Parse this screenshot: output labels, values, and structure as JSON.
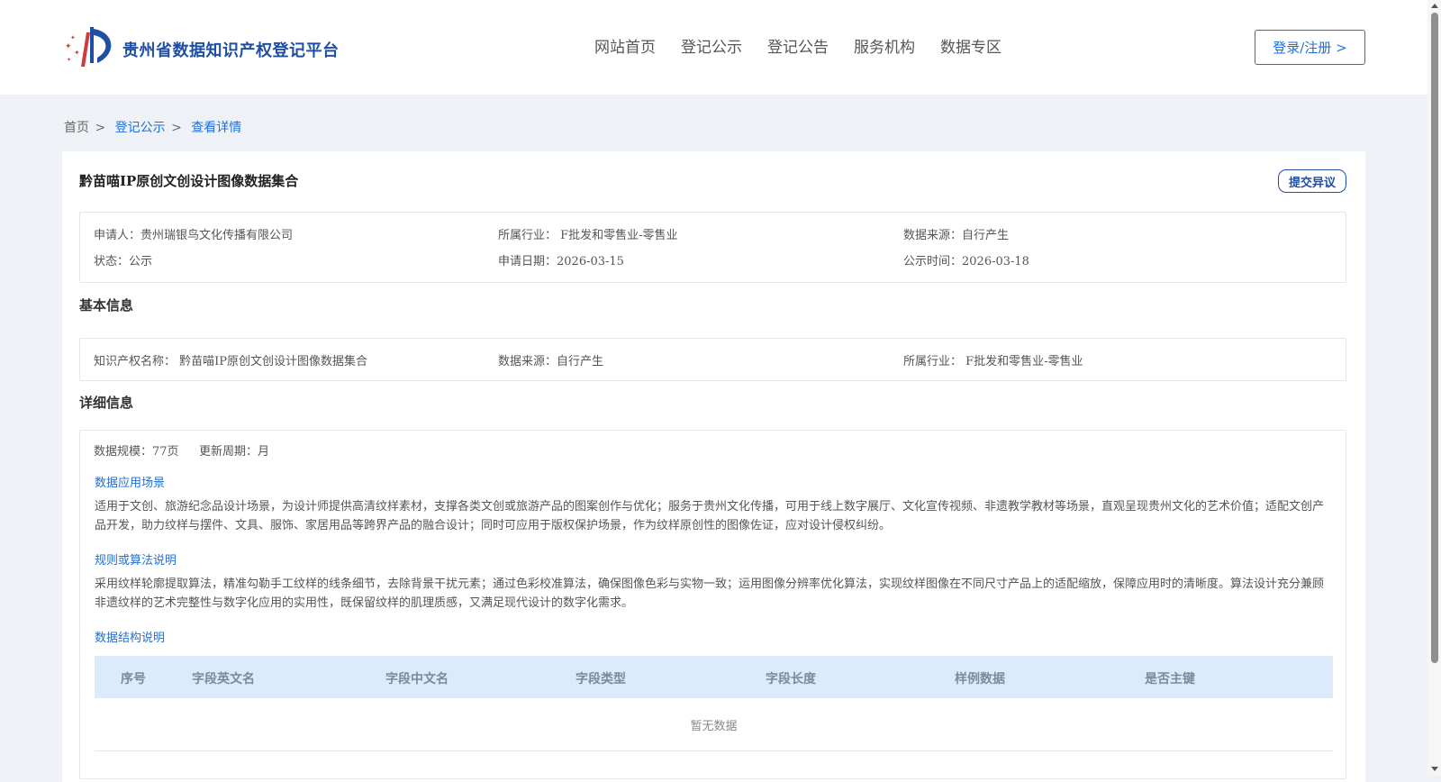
{
  "header": {
    "brand": "贵州省数据知识产权登记平台",
    "nav": [
      "网站首页",
      "登记公示",
      "登记公告",
      "服务机构",
      "数据专区"
    ],
    "login_label": "登录/注册 >"
  },
  "breadcrumb": {
    "home": "首页",
    "sep": ">",
    "list": "登记公示",
    "detail": "查看详情"
  },
  "record": {
    "title": "黔苗喵IP原创文创设计图像数据集合",
    "objection_label": "提交异议",
    "summary": {
      "applicant": "申请人：贵州瑞银鸟文化传播有限公司",
      "industry": "所属行业： F批发和零售业-零售业",
      "source": "数据来源：自行产生",
      "status": "状态：公示",
      "apply_date": "申请日期：2026-03-15",
      "publish_time": "公示时间：2026-03-18"
    }
  },
  "basic": {
    "title": "基本信息",
    "ip_name": "知识产权名称： 黔苗喵IP原创文创设计图像数据集合",
    "source": "数据来源：自行产生",
    "industry": "所属行业： F批发和零售业-零售业"
  },
  "detail": {
    "title": "详细信息",
    "scale": "数据规模：77页",
    "cycle": "更新周期：月",
    "usage_title": "数据应用场景",
    "usage_text": "适用于文创、旅游纪念品设计场景，为设计师提供高清纹样素材，支撑各类文创或旅游产品的图案创作与优化；服务于贵州文化传播，可用于线上数字展厅、文化宣传视频、非遗教学教材等场景，直观呈现贵州文化的艺术价值；适配文创产品开发，助力纹样与摆件、文具、服饰、家居用品等跨界产品的融合设计；同时可应用于版权保护场景，作为纹样原创性的图像佐证，应对设计侵权纠纷。",
    "algo_title": "规则或算法说明",
    "algo_text": "采用纹样轮廓提取算法，精准勾勒手工纹样的线条细节，去除背景干扰元素；通过色彩校准算法，确保图像色彩与实物一致；运用图像分辨率优化算法，实现纹样图像在不同尺寸产品上的适配缩放，保障应用时的清晰度。算法设计充分兼顾非遗纹样的艺术完整性与数字化应用的实用性，既保留纹样的肌理质感，又满足现代设计的数字化需求。",
    "structure_title": "数据结构说明",
    "table": {
      "columns": [
        "序号",
        "字段英文名",
        "字段中文名",
        "字段类型",
        "字段长度",
        "样例数据",
        "是否主键"
      ],
      "empty_text": "暂无数据"
    }
  },
  "colors": {
    "accent": "#1e6fd9",
    "brand": "#1f4fa3",
    "table_header": "#dcebfb",
    "page_bg": "#eef1f6"
  }
}
